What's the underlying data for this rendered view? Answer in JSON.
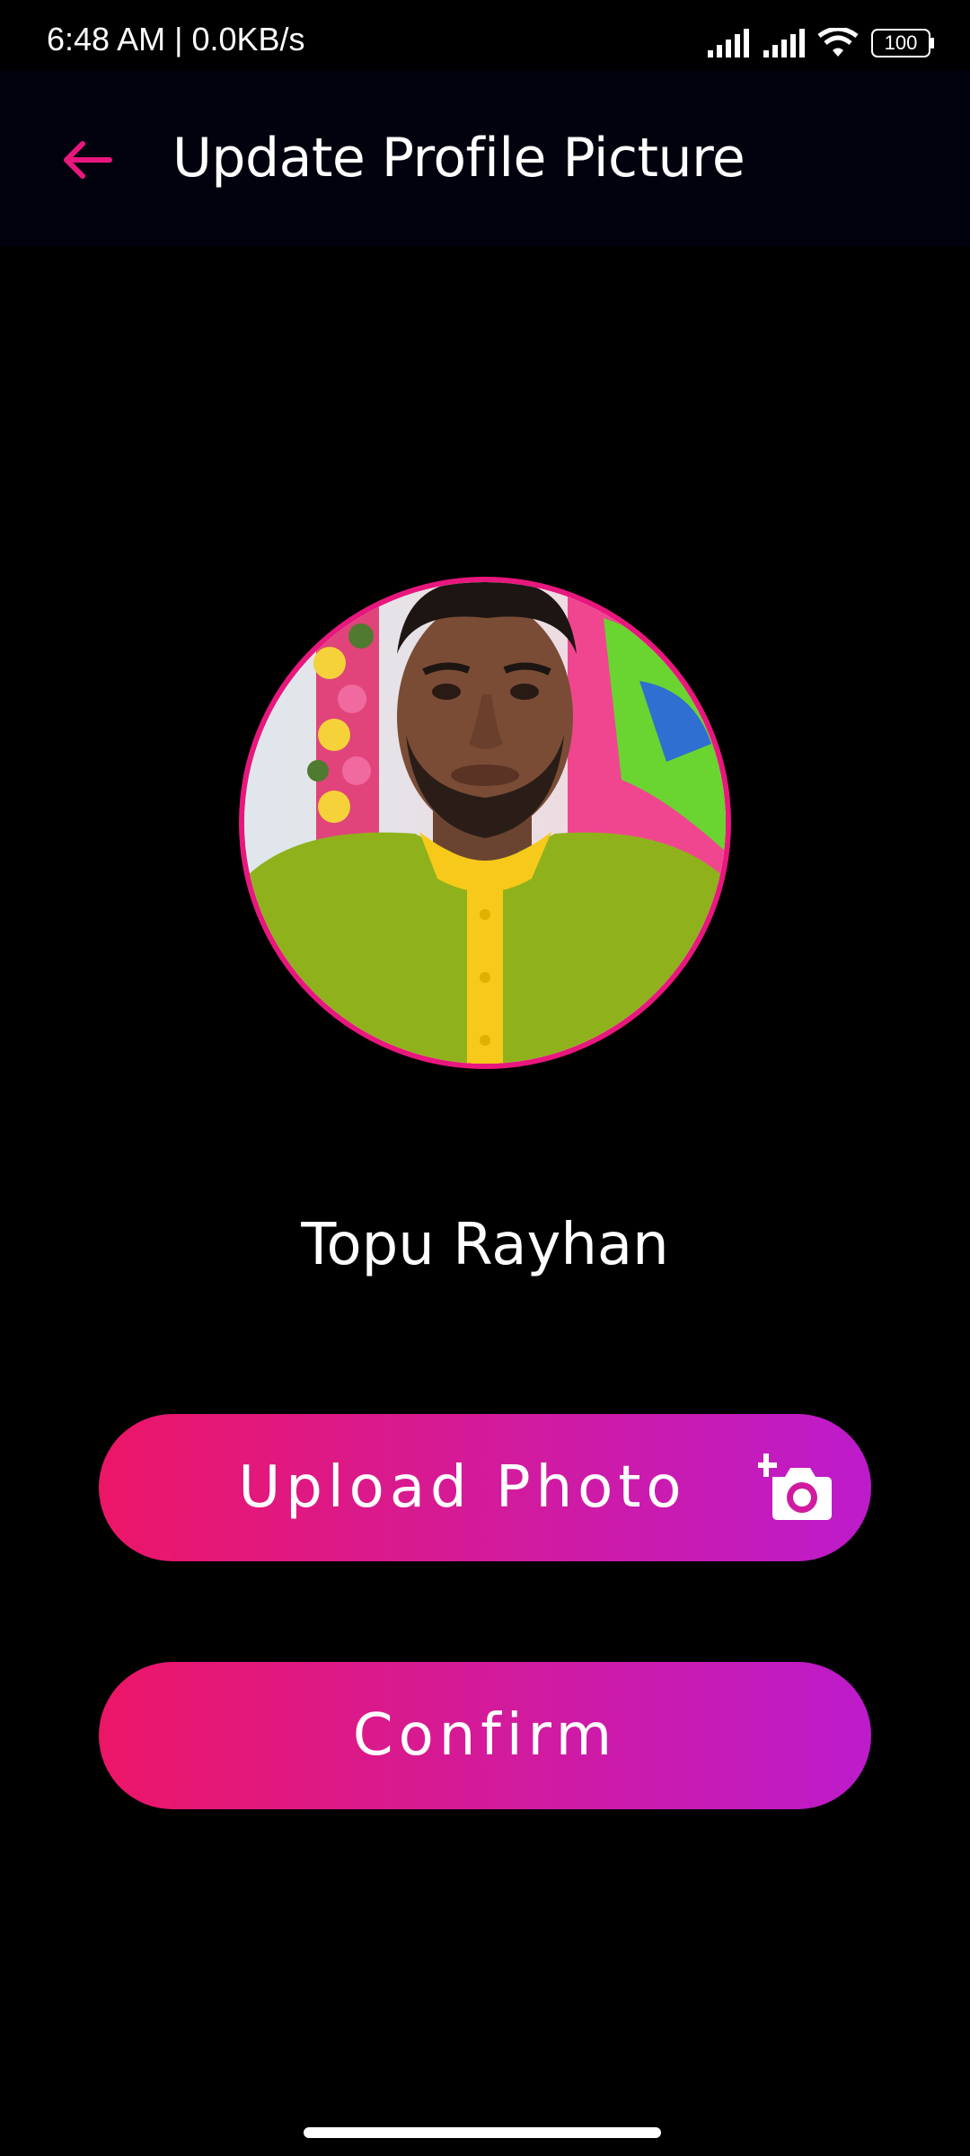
{
  "status_bar": {
    "time_and_speed": "6:48 AM | 0.0KB/s",
    "battery": "100",
    "icons": [
      "signal-icon",
      "signal-icon",
      "wifi-icon",
      "battery-icon"
    ]
  },
  "app_bar": {
    "back_icon": "arrow-left-icon",
    "title": "Update Profile Picture"
  },
  "profile": {
    "name": "Topu Rayhan",
    "avatar_alt": "profile photo"
  },
  "actions": {
    "upload_label": "Upload Photo",
    "upload_icon": "add-camera-icon",
    "confirm_label": "Confirm"
  },
  "colors": {
    "accent": "#e8177d",
    "gradient_start": "#ec1667",
    "gradient_end": "#bd1bcb",
    "background": "#000000",
    "app_bar": "#02020e"
  }
}
